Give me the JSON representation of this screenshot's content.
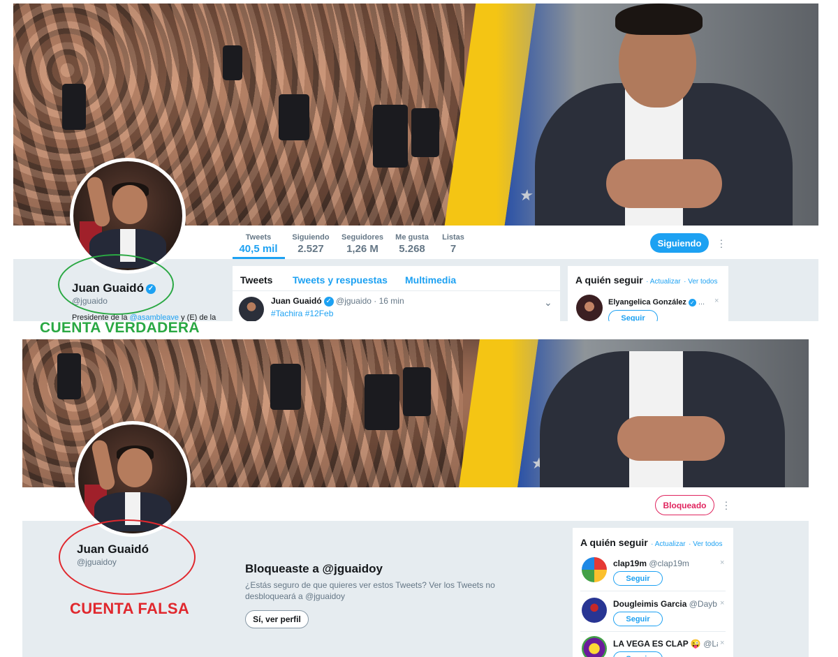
{
  "real_profile": {
    "stats": [
      {
        "label": "Tweets",
        "value": "40,5 mil"
      },
      {
        "label": "Siguiendo",
        "value": "2.527"
      },
      {
        "label": "Seguidores",
        "value": "1,26 M"
      },
      {
        "label": "Me gusta",
        "value": "5.268"
      },
      {
        "label": "Listas",
        "value": "7"
      }
    ],
    "follow_button": "Siguiendo",
    "name": "Juan Guaidó",
    "handle": "@jguaido",
    "bio_start": "Presidente de la ",
    "bio_link": "@asambleave",
    "bio_end": " y (E) de la",
    "tabs": [
      "Tweets",
      "Tweets y respuestas",
      "Multimedia"
    ],
    "tweet": {
      "name": "Juan Guaidó",
      "handle": "@jguaido",
      "time": "· 16 min",
      "text": "#Tachira #12Feb"
    },
    "who_to_follow": {
      "title": "A quién seguir",
      "refresh": "· Actualizar",
      "view_all": "· Ver todos",
      "items": [
        {
          "name": "Elyangelica González",
          "handle": "...",
          "button": "Seguir"
        }
      ]
    },
    "annotation": "CUENTA VERDADERA",
    "annotation_color": "#2aa843"
  },
  "fake_profile": {
    "blocked_button": "Bloqueado",
    "name": "Juan Guaidó",
    "handle": "@jguaidoy",
    "blocked_title": "Bloqueaste a @jguaidoy",
    "blocked_text": "¿Estás seguro de que quieres ver estos Tweets? Ver los Tweets no desbloqueará a @jguaidoy",
    "view_profile_button": "Sí, ver perfil",
    "who_to_follow": {
      "title": "A quién seguir",
      "refresh": "· Actualizar",
      "view_all": "· Ver todos",
      "items": [
        {
          "name": "clap19m",
          "handle": "@clap19m",
          "button": "Seguir"
        },
        {
          "name": "Dougleimis Garcia",
          "handle": "@Dayb...",
          "button": "Seguir"
        },
        {
          "name": "LA VEGA ES CLAP 😜",
          "handle": "@La...",
          "button": "Seguir"
        }
      ]
    },
    "annotation": "CUENTA FALSA",
    "annotation_color": "#e0282e"
  },
  "colors": {
    "twitter_blue": "#1da1f2",
    "blocked_red": "#e0245e",
    "gray_bg": "#e6ecf0"
  },
  "icons": [
    "verified-badge-icon",
    "more-options-icon",
    "chevron-down-icon",
    "close-icon"
  ]
}
